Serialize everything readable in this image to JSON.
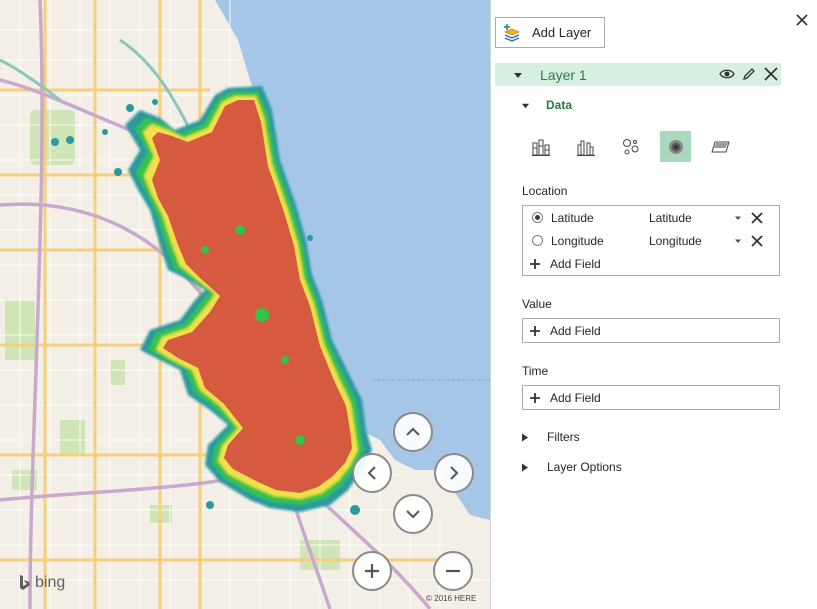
{
  "map": {
    "attribution": "© 2016 HERE",
    "logo_text": "bing",
    "colors": {
      "water": "#a6c6e8",
      "land": "#f3efe6",
      "park": "#cfe5b8",
      "major_road": "#f6cf7a",
      "highway": "#c9a8cf",
      "heat_core": "#d55a3f",
      "heat_yellow": "#f2e04a",
      "heat_green": "#35c24a",
      "heat_teal": "#2b9a9d"
    },
    "nav_controls": [
      "pan-up",
      "pan-left",
      "pan-right",
      "pan-down",
      "zoom-in",
      "zoom-out"
    ]
  },
  "panel": {
    "add_layer_label": "Add Layer",
    "layer": {
      "name": "Layer 1",
      "tools": [
        "eye-icon",
        "pencil-icon",
        "close-icon"
      ]
    },
    "data_section": {
      "label": "Data",
      "viz_types": [
        {
          "name": "stacked-column-icon",
          "active": false
        },
        {
          "name": "clustered-column-icon",
          "active": false
        },
        {
          "name": "bubble-icon",
          "active": false
        },
        {
          "name": "heat-map-icon",
          "active": true
        },
        {
          "name": "region-icon",
          "active": false
        }
      ]
    },
    "location": {
      "label": "Location",
      "fields": [
        {
          "name": "Latitude",
          "type": "Latitude",
          "selected": true
        },
        {
          "name": "Longitude",
          "type": "Longitude",
          "selected": false
        }
      ],
      "add_field": "Add Field"
    },
    "value": {
      "label": "Value",
      "add_field": "Add Field"
    },
    "time": {
      "label": "Time",
      "add_field": "Add Field"
    },
    "filters_label": "Filters",
    "layer_options_label": "Layer Options"
  }
}
